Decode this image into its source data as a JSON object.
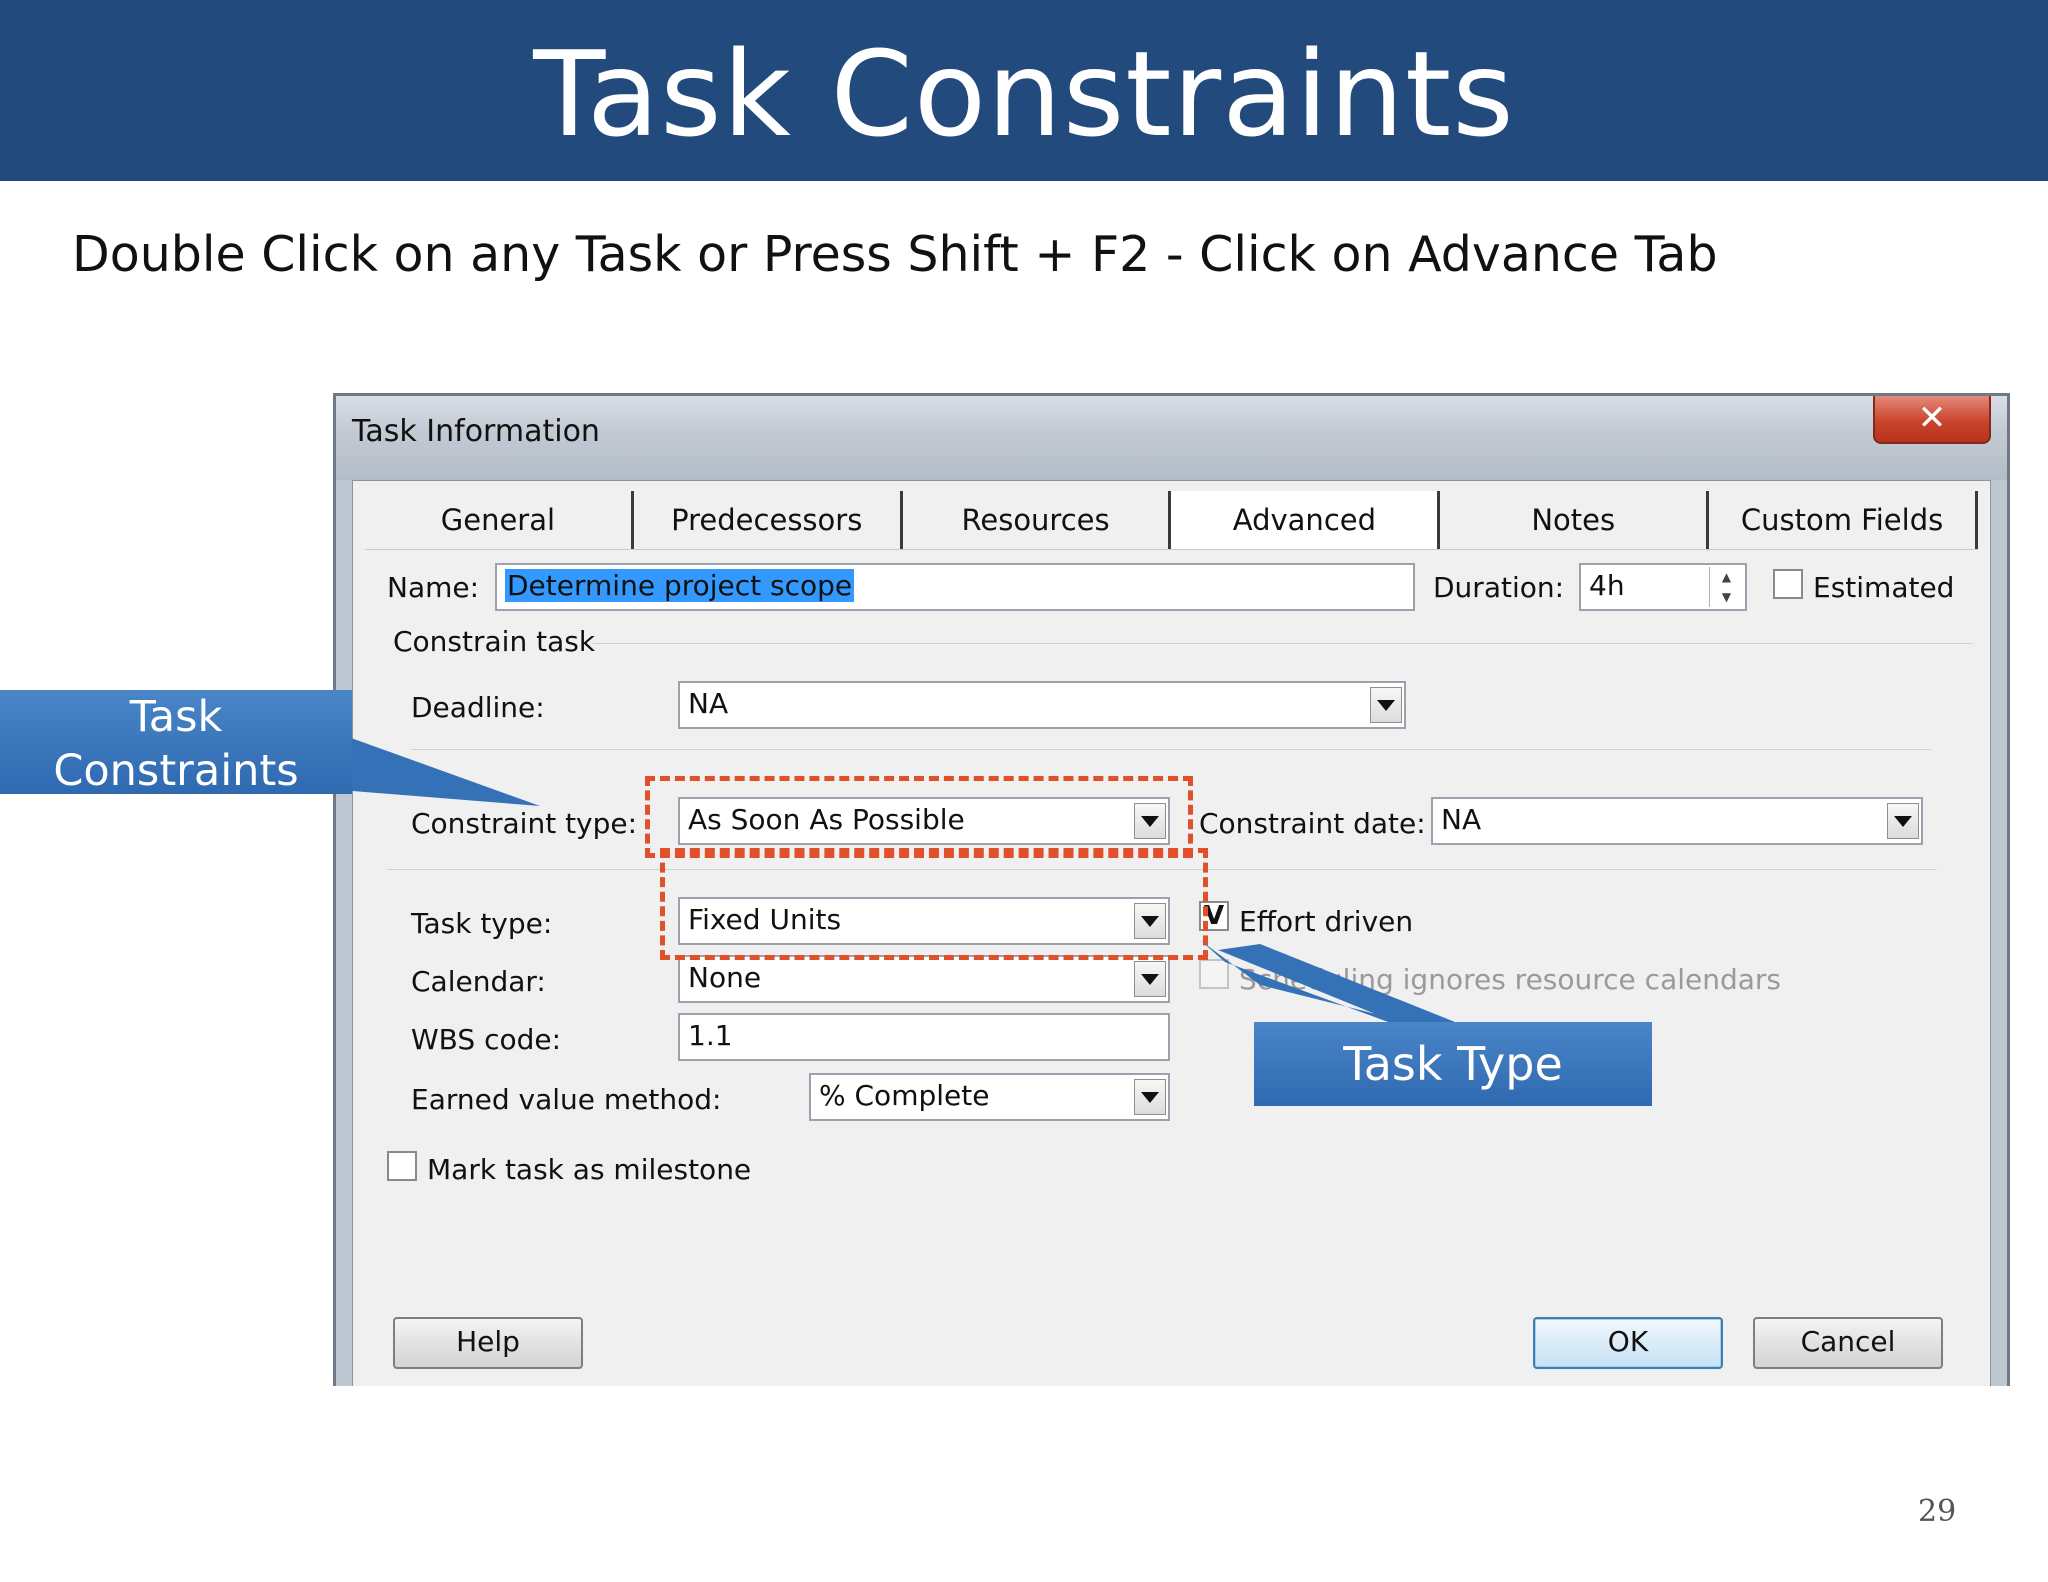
{
  "slide": {
    "title": "Task Constraints",
    "instruction": "Double Click on any Task or Press Shift + F2 - Click on Advance Tab",
    "page_number": "29"
  },
  "dialog": {
    "title": "Task Information",
    "close_label": "✕",
    "tabs": [
      {
        "label": "General"
      },
      {
        "label": "Predecessors"
      },
      {
        "label": "Resources"
      },
      {
        "label": "Advanced",
        "active": true
      },
      {
        "label": "Notes"
      },
      {
        "label": "Custom Fields"
      }
    ],
    "name_label": "Name:",
    "name_value": "Determine project scope",
    "duration_label": "Duration:",
    "duration_value": "4h",
    "estimated_label": "Estimated",
    "estimated_checked": false,
    "constrain_task_label": "Constrain task",
    "deadline_label": "Deadline:",
    "deadline_value": "NA",
    "constraint_type_label": "Constraint type:",
    "constraint_type_value": "As Soon As Possible",
    "constraint_date_label": "Constraint date:",
    "constraint_date_value": "NA",
    "task_type_label": "Task type:",
    "task_type_value": "Fixed Units",
    "effort_driven_label": "Effort driven",
    "effort_driven_mark": "V",
    "calendar_label": "Calendar:",
    "calendar_value": "None",
    "scheduling_label": "Scheduling ignores resource calendars",
    "wbs_label": "WBS code:",
    "wbs_value": "1.1",
    "earned_value_label": "Earned value method:",
    "earned_value_value": "% Complete",
    "milestone_label": "Mark task as milestone",
    "help_label": "Help",
    "ok_label": "OK",
    "cancel_label": "Cancel"
  },
  "callouts": {
    "constraints_line1": "Task",
    "constraints_line2": "Constraints",
    "task_type": "Task Type"
  },
  "colors": {
    "title_bar": "#224a7c",
    "callout": "#2f69b0",
    "highlight_dash": "#e0502a"
  }
}
